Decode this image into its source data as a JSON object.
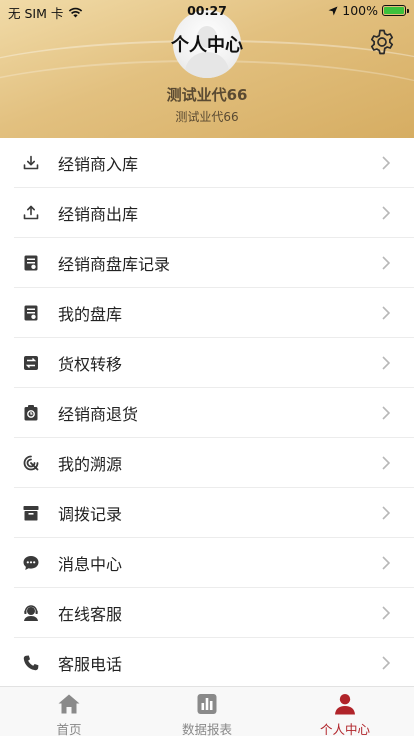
{
  "status_bar": {
    "carrier": "无 SIM 卡",
    "time": "00:27",
    "battery": "100%"
  },
  "header": {
    "title": "个人中心",
    "username": "测试业代66",
    "subname": "测试业代66"
  },
  "menu": [
    {
      "label": "经销商入库",
      "icon": "download-icon"
    },
    {
      "label": "经销商出库",
      "icon": "upload-icon"
    },
    {
      "label": "经销商盘库记录",
      "icon": "inventory-record-icon"
    },
    {
      "label": "我的盘库",
      "icon": "inventory-icon"
    },
    {
      "label": "货权转移",
      "icon": "transfer-icon"
    },
    {
      "label": "经销商退货",
      "icon": "return-icon"
    },
    {
      "label": "我的溯源",
      "icon": "trace-icon"
    },
    {
      "label": "调拨记录",
      "icon": "archive-icon"
    },
    {
      "label": "消息中心",
      "icon": "message-icon"
    },
    {
      "label": "在线客服",
      "icon": "support-agent-icon"
    },
    {
      "label": "客服电话",
      "icon": "phone-icon"
    }
  ],
  "tabs": [
    {
      "label": "首页",
      "icon": "home-icon",
      "active": false
    },
    {
      "label": "数据报表",
      "icon": "bar-chart-icon",
      "active": false
    },
    {
      "label": "个人中心",
      "icon": "user-icon",
      "active": true
    }
  ],
  "colors": {
    "accent": "#b0242a",
    "header_gold": "#e2c07f",
    "icon_dark": "#3a3a3a",
    "chevron": "#b8b8b8"
  }
}
